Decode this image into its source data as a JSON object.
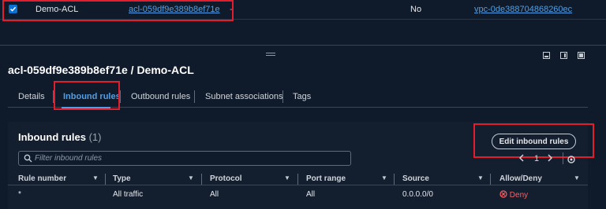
{
  "top_row": {
    "name": "Demo-ACL",
    "acl_id": "acl-059df9e389b8ef71e",
    "dash": "-",
    "default": "No",
    "vpc_id": "vpc-0de388704868260ec"
  },
  "detail": {
    "title": "acl-059df9e389b8ef71e / Demo-ACL",
    "tabs": [
      "Details",
      "Inbound rules",
      "Outbound rules",
      "Subnet associations",
      "Tags"
    ]
  },
  "inbound": {
    "title": "Inbound rules",
    "count": "(1)",
    "edit_button": "Edit inbound rules",
    "search_placeholder": "Filter inbound rules",
    "page": "1",
    "columns": [
      "Rule number",
      "Type",
      "Protocol",
      "Port range",
      "Source",
      "Allow/Deny"
    ],
    "rows": [
      {
        "rule_number": "*",
        "type": "All traffic",
        "protocol": "All",
        "port_range": "All",
        "source": "0.0.0.0/0",
        "action": "Deny"
      }
    ]
  },
  "colors": {
    "link": "#539fe5",
    "accent_selected": "#0972d3",
    "highlight_box": "#e11d2e",
    "deny": "#ff5d64"
  }
}
